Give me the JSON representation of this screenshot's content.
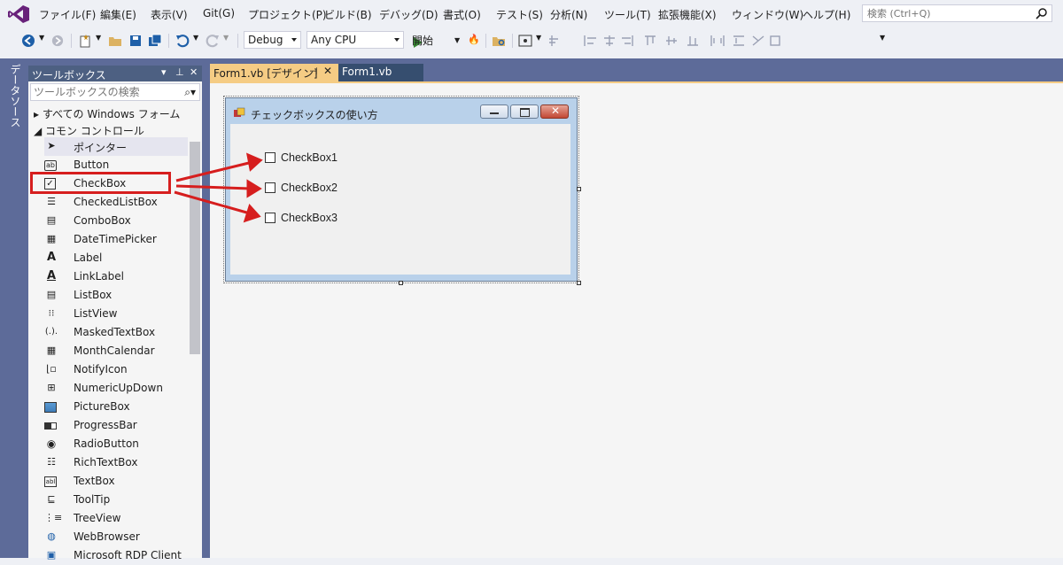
{
  "menubar": {
    "items": [
      "ファイル(F)",
      "編集(E)",
      "表示(V)",
      "Git(G)",
      "プロジェクト(P)",
      "ビルド(B)",
      "デバッグ(D)",
      "書式(O)",
      "テスト(S)",
      "分析(N)",
      "ツール(T)",
      "拡張機能(X)",
      "ウィンドウ(W)",
      "ヘルプ(H)"
    ],
    "search_placeholder": "検索 (Ctrl+Q)"
  },
  "toolbar": {
    "config": "Debug",
    "platform": "Any CPU",
    "run_label": "開始"
  },
  "side_tab": {
    "label": "データソース"
  },
  "toolbox": {
    "title": "ツールボックス",
    "search_placeholder": "ツールボックスの検索",
    "group_all": "すべての Windows フォーム",
    "group_common": "コモン コントロール",
    "items": [
      {
        "label": "ポインター",
        "icon": "pointer-icon"
      },
      {
        "label": "Button",
        "icon": "button-icon"
      },
      {
        "label": "CheckBox",
        "icon": "checkbox-icon"
      },
      {
        "label": "CheckedListBox",
        "icon": "checkedlistbox-icon"
      },
      {
        "label": "ComboBox",
        "icon": "combobox-icon"
      },
      {
        "label": "DateTimePicker",
        "icon": "datetimepicker-icon"
      },
      {
        "label": "Label",
        "icon": "label-icon"
      },
      {
        "label": "LinkLabel",
        "icon": "linklabel-icon"
      },
      {
        "label": "ListBox",
        "icon": "listbox-icon"
      },
      {
        "label": "ListView",
        "icon": "listview-icon"
      },
      {
        "label": "MaskedTextBox",
        "icon": "maskedtextbox-icon"
      },
      {
        "label": "MonthCalendar",
        "icon": "monthcalendar-icon"
      },
      {
        "label": "NotifyIcon",
        "icon": "notifyicon-icon"
      },
      {
        "label": "NumericUpDown",
        "icon": "numericupdown-icon"
      },
      {
        "label": "PictureBox",
        "icon": "picturebox-icon"
      },
      {
        "label": "ProgressBar",
        "icon": "progressbar-icon"
      },
      {
        "label": "RadioButton",
        "icon": "radiobutton-icon"
      },
      {
        "label": "RichTextBox",
        "icon": "richtextbox-icon"
      },
      {
        "label": "TextBox",
        "icon": "textbox-icon"
      },
      {
        "label": "ToolTip",
        "icon": "tooltip-icon"
      },
      {
        "label": "TreeView",
        "icon": "treeview-icon"
      },
      {
        "label": "WebBrowser",
        "icon": "webbrowser-icon"
      },
      {
        "label": "Microsoft RDP Client",
        "icon": "rdpclient-icon"
      }
    ]
  },
  "doc_tabs": {
    "active": "Form1.vb [デザイン]",
    "inactive": "Form1.vb"
  },
  "form": {
    "title": "チェックボックスの使い方",
    "checkboxes": [
      "CheckBox1",
      "CheckBox2",
      "CheckBox3"
    ]
  },
  "colors": {
    "accent": "#f5cc84",
    "highlight": "#d61e1e",
    "chrome": "#5d6b99"
  }
}
